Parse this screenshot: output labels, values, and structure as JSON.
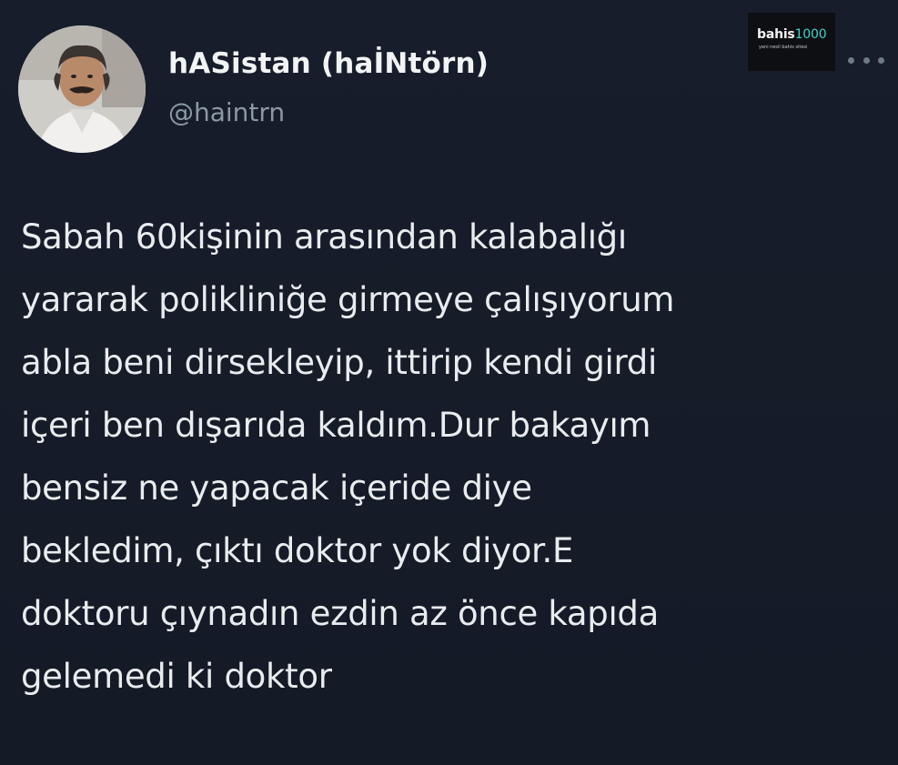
{
  "author": {
    "display_name": "hASistan (haİNtörn)",
    "handle": "@haintrn"
  },
  "watermark": {
    "logo_prefix": "bahis",
    "logo_suffix": "1000",
    "tagline": "yeni nesil bahis sitesi"
  },
  "more_menu": {
    "icon": "more-horizontal-icon"
  },
  "tweet": {
    "lines": [
      "Sabah 60kişinin arasından kalabalığı",
      "yararak polikliniğe girmeye çalışıyorum",
      "abla beni dirsekleyip, ittirip kendi girdi",
      "içeri ben dışarıda kaldım.Dur bakayım",
      "bensiz ne yapacak içeride diye",
      "bekledim, çıktı doktor yok diyor.E",
      "doktoru çıynadın ezdin az önce kapıda",
      "gelemedi ki doktor"
    ]
  },
  "colors": {
    "background": "#15202b",
    "text": "#e7e9ea",
    "secondary_text": "#8b98a5",
    "watermark_accent": "#3ad6c9"
  }
}
